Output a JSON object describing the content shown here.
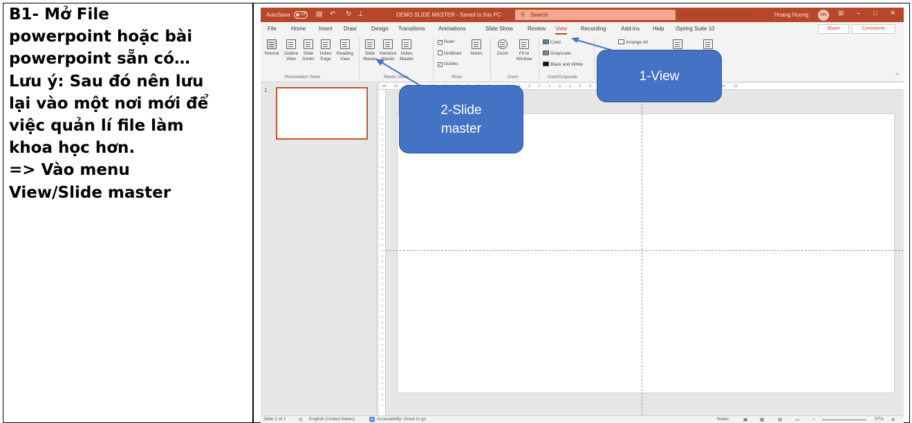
{
  "instructions": {
    "lines": [
      "B1- Mở File",
      "powerpoint hoặc bài",
      "powerpoint sẵn có…",
      "Lưu ý: Sau đó nên lưu",
      "lại vào một nơi mới để",
      "việc quản lí file làm",
      "khoa học hơn.",
      "=> Vào menu",
      "View/Slide master"
    ]
  },
  "titlebar": {
    "autosave": "AutoSave",
    "toggle_state": "Off",
    "doc_title": "DEMO SLIDE MASTER - Saved to this PC",
    "search_placeholder": "Search",
    "user_name": "Hoang Huong",
    "user_initials": "HH"
  },
  "tabs": [
    "File",
    "Home",
    "Insert",
    "Draw",
    "Design",
    "Transitions",
    "Animations",
    "Slide Show",
    "Review",
    "View",
    "Recording",
    "Add-ins",
    "Help",
    "iSpring Suite 10"
  ],
  "active_tab": "View",
  "share_label": "Share",
  "comments_label": "Comments",
  "ribbon": {
    "presentation_views": {
      "buttons": [
        "Normal",
        "Outline View",
        "Slide Sorter",
        "Notes Page",
        "Reading View"
      ],
      "label": "Presentation Views"
    },
    "master_views": {
      "buttons": [
        "Slide Master",
        "Handout Master",
        "Notes Master"
      ],
      "label": "Master Views"
    },
    "show": {
      "checkboxes": [
        "Ruler",
        "Gridlines",
        "Guides"
      ],
      "notes": "Notes",
      "label": "Show"
    },
    "zoom": {
      "buttons": [
        "Zoom",
        "Fit to Window"
      ],
      "label": "Zoom"
    },
    "color": {
      "options": [
        "Color",
        "Grayscale",
        "Black and White"
      ],
      "label": "Color/Grayscale"
    },
    "window": {
      "arrange_all": "Arrange All"
    }
  },
  "slide_number": "1",
  "statusbar": {
    "slide_info": "Slide 1 of 1",
    "language": "English (United States)",
    "accessibility": "Accessibility: Good to go",
    "notes": "Notes",
    "zoom": "37%"
  },
  "callouts": {
    "view": "1-View",
    "slide_master_line1": "2-Slide",
    "slide_master_line2": "master"
  },
  "colors": {
    "accent": "#b7472a",
    "callout": "#4472c4"
  }
}
